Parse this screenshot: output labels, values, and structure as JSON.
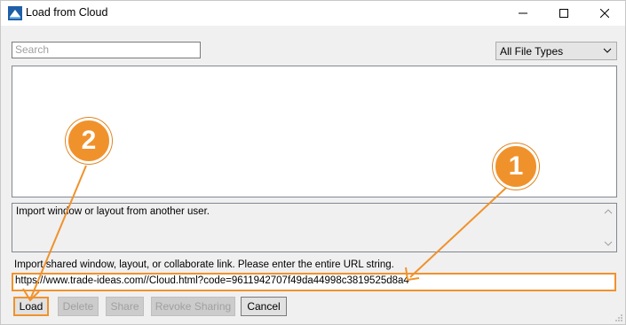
{
  "window": {
    "title": "Load from Cloud",
    "controls": {
      "minimize": "—",
      "maximize": "☐",
      "close": "✕"
    }
  },
  "search": {
    "placeholder": "Search",
    "value": ""
  },
  "file_type_select": {
    "selected": "All File Types"
  },
  "file_list": {
    "items": []
  },
  "description": {
    "text": "Import window or layout from another user."
  },
  "import": {
    "label": "Import shared window, layout, or collaborate link. Please enter the entire URL string.",
    "url_value": "https://www.trade-ideas.com//Cloud.html?code=9611942707f49da44998c3819525d8a4"
  },
  "buttons": {
    "load": "Load",
    "delete": "Delete",
    "share": "Share",
    "revoke": "Revoke Sharing",
    "cancel": "Cancel"
  },
  "annotations": {
    "step1": "1",
    "step2": "2",
    "accent_color": "#f0922c"
  }
}
